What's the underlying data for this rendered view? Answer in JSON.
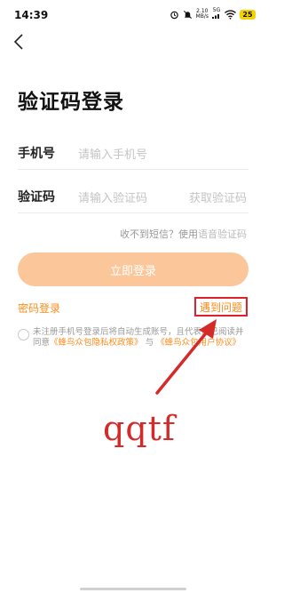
{
  "status_bar": {
    "time": "14:39",
    "net_speed_value": "2.10",
    "net_speed_unit": "MB/s",
    "network": "5G",
    "battery": "25"
  },
  "header": {
    "back_icon": "chevron-left-icon"
  },
  "title": "验证码登录",
  "phone": {
    "label": "手机号",
    "placeholder": "请输入手机号"
  },
  "code": {
    "label": "验证码",
    "placeholder": "请输入验证码",
    "get_code": "获取验证码"
  },
  "sms_hint": {
    "text": "收不到短信？使用",
    "link": "语音验证码"
  },
  "login_button": "立即登录",
  "password_login": "密码登录",
  "problem_link": "遇到问题",
  "terms": {
    "text1": "未注册手机号登录后将自动生成账号，且代表您已阅读并同意",
    "privacy": "《蜂鸟众包隐私权政策》",
    "and": "与",
    "agreement": "《蜂鸟众包用户协议》"
  },
  "annotation": {
    "handwritten_text": "qqtf",
    "color": "#d42a2a"
  },
  "colors": {
    "accent": "#ff8b1a",
    "button": "#fbc79a"
  }
}
